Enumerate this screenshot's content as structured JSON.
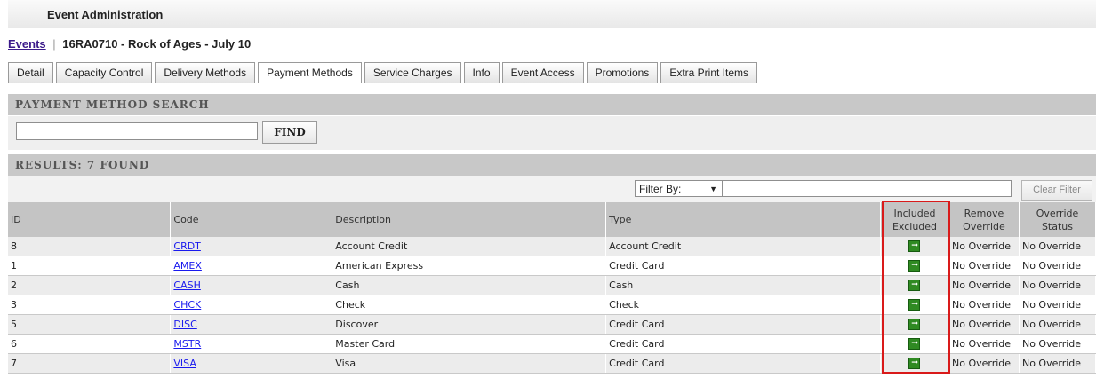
{
  "app": {
    "title": "Event Administration"
  },
  "breadcrumb": {
    "events_link": "Events",
    "separator": "|",
    "event_name": "16RA0710 - Rock of Ages - July 10"
  },
  "tabs": [
    {
      "label": "Detail"
    },
    {
      "label": "Capacity Control"
    },
    {
      "label": "Delivery Methods"
    },
    {
      "label": "Payment Methods"
    },
    {
      "label": "Service Charges"
    },
    {
      "label": "Info"
    },
    {
      "label": "Event Access"
    },
    {
      "label": "Promotions"
    },
    {
      "label": "Extra Print Items"
    }
  ],
  "active_tab": "Payment Methods",
  "search": {
    "heading": "PAYMENT METHOD SEARCH",
    "value": "",
    "placeholder": "",
    "find_label": "FIND"
  },
  "results": {
    "heading": "RESULTS: 7 FOUND",
    "filter_label": "Filter By:",
    "filter_value": "",
    "clear_label": "Clear Filter",
    "columns": {
      "id": "ID",
      "code": "Code",
      "description": "Description",
      "type": "Type",
      "included_1": "Included",
      "included_2": "Excluded",
      "remove_1": "Remove",
      "remove_2": "Override",
      "status_1": "Override",
      "status_2": "Status"
    },
    "rows": [
      {
        "id": "8",
        "code": "CRDT",
        "description": "Account Credit",
        "type": "Account Credit",
        "remove": "No Override",
        "status": "No Override"
      },
      {
        "id": "1",
        "code": "AMEX",
        "description": "American Express",
        "type": "Credit Card",
        "remove": "No Override",
        "status": "No Override"
      },
      {
        "id": "2",
        "code": "CASH",
        "description": "Cash",
        "type": "Cash",
        "remove": "No Override",
        "status": "No Override"
      },
      {
        "id": "3",
        "code": "CHCK",
        "description": "Check",
        "type": "Check",
        "remove": "No Override",
        "status": "No Override"
      },
      {
        "id": "5",
        "code": "DISC",
        "description": "Discover",
        "type": "Credit Card",
        "remove": "No Override",
        "status": "No Override"
      },
      {
        "id": "6",
        "code": "MSTR",
        "description": "Master Card",
        "type": "Credit Card",
        "remove": "No Override",
        "status": "No Override"
      },
      {
        "id": "7",
        "code": "VISA",
        "description": "Visa",
        "type": "Credit Card",
        "remove": "No Override",
        "status": "No Override"
      }
    ]
  },
  "icons": {
    "include_toggle": "green-arrow-into-box-icon",
    "dropdown": "chevron-down-icon"
  },
  "colors": {
    "highlight_border": "#d91a1a",
    "include_icon": "#2f8a22",
    "link": "#1a1aee"
  }
}
